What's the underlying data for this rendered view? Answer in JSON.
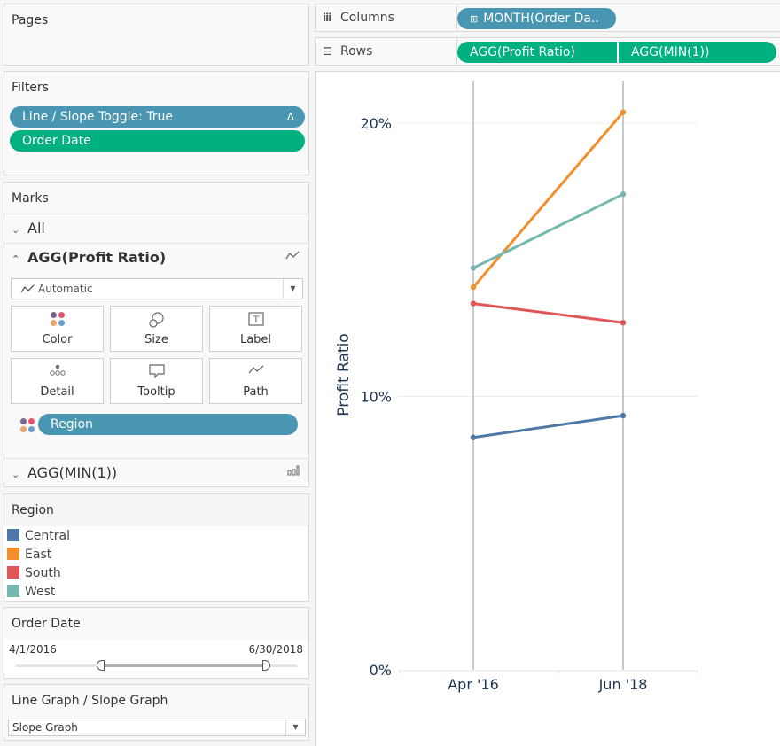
{
  "pages": {
    "title": "Pages"
  },
  "filters": {
    "title": "Filters",
    "items": [
      {
        "label": "Line / Slope Toggle: True",
        "icon": "delta-icon",
        "glyph": "Δ",
        "color": "#4996b2"
      },
      {
        "label": "Order Date",
        "color": "#00b180"
      }
    ]
  },
  "marks": {
    "title": "Marks",
    "all_label": "All",
    "primary_label": "AGG(Profit Ratio)",
    "mark_type": "Automatic",
    "buttons": [
      {
        "label": "Color",
        "icon": "color-icon"
      },
      {
        "label": "Size",
        "icon": "size-icon"
      },
      {
        "label": "Label",
        "icon": "label-icon"
      },
      {
        "label": "Detail",
        "icon": "detail-icon"
      },
      {
        "label": "Tooltip",
        "icon": "tooltip-icon"
      },
      {
        "label": "Path",
        "icon": "path-icon"
      }
    ],
    "color_pill": "Region",
    "secondary_label": "AGG(MIN(1))"
  },
  "shelves": {
    "columns": {
      "label": "Columns",
      "pill": "MONTH(Order Da.."
    },
    "rows": {
      "label": "Rows",
      "pills": [
        "AGG(Profit Ratio)",
        "AGG(MIN(1))"
      ]
    }
  },
  "legend": {
    "title": "Region",
    "items": [
      {
        "label": "Central",
        "color": "#4e79a7"
      },
      {
        "label": "East",
        "color": "#f28e2b"
      },
      {
        "label": "South",
        "color": "#e15759"
      },
      {
        "label": "West",
        "color": "#76b7b2"
      }
    ]
  },
  "order_date_filter": {
    "title": "Order Date",
    "min": "4/1/2016",
    "max": "6/30/2018",
    "range_start_fraction": 0.3,
    "range_end_fraction": 0.89
  },
  "toggle": {
    "title": "Line Graph / Slope Graph",
    "value": "Slope Graph"
  },
  "chart_data": {
    "type": "line",
    "title": "",
    "xlabel": "",
    "ylabel": "Profit Ratio",
    "categories": [
      "Apr '16",
      "Jun '18"
    ],
    "y_ticks": [
      "0%",
      "10%",
      "20%"
    ],
    "y_tick_values": [
      0,
      10,
      20
    ],
    "ylim": [
      0,
      21.5
    ],
    "grid": true,
    "series": [
      {
        "name": "Central",
        "color": "#4e79a7",
        "values": [
          8.5,
          9.3
        ]
      },
      {
        "name": "East",
        "color": "#f28e2b",
        "values": [
          14.0,
          20.4
        ]
      },
      {
        "name": "South",
        "color": "#e15759",
        "values": [
          13.4,
          12.7
        ]
      },
      {
        "name": "West",
        "color": "#76b7b2",
        "values": [
          14.7,
          17.4
        ]
      }
    ]
  }
}
